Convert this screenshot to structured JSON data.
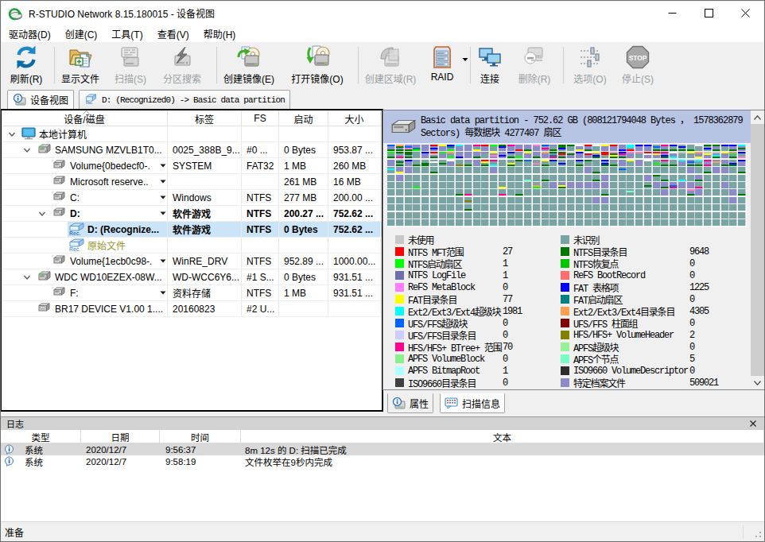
{
  "window": {
    "title": "R-STUDIO Network 8.15.180015 - 设备视图"
  },
  "menu": {
    "items": [
      "驱动器(D)",
      "创建(C)",
      "工具(T)",
      "查看(V)",
      "帮助(H)"
    ]
  },
  "toolbar": {
    "items": [
      {
        "id": "refresh",
        "label": "刷新(R)",
        "icon": "refresh-icon",
        "enabled": true
      },
      {
        "id": "show-files",
        "label": "显示文件",
        "icon": "show-files-icon",
        "enabled": true
      },
      {
        "id": "scan",
        "label": "扫描(S)",
        "icon": "scan-icon",
        "enabled": false
      },
      {
        "id": "search-partition",
        "label": "分区搜索",
        "icon": "partition-search-icon",
        "enabled": false
      },
      {
        "id": "create-image",
        "label": "创建镜像(E)",
        "icon": "create-image-icon",
        "enabled": true
      },
      {
        "id": "open-image",
        "label": "打开镜像(O)",
        "icon": "open-image-icon",
        "enabled": true
      },
      {
        "id": "create-region",
        "label": "创建区域(R)",
        "icon": "create-region-icon",
        "enabled": false
      },
      {
        "id": "raid",
        "label": "RAID",
        "icon": "raid-icon",
        "enabled": true,
        "dropdown": true
      },
      {
        "id": "connect",
        "label": "连接",
        "icon": "connect-icon",
        "enabled": true
      },
      {
        "id": "delete",
        "label": "删除(R)",
        "icon": "delete-icon",
        "enabled": false
      },
      {
        "id": "options",
        "label": "选项(O)",
        "icon": "options-icon",
        "enabled": false
      },
      {
        "id": "stop",
        "label": "停止(S)",
        "icon": "stop-icon",
        "enabled": false
      }
    ]
  },
  "tabs": [
    {
      "label": "设备视图",
      "icon": "device-view-icon",
      "active": true
    },
    {
      "label": "D: (Recognized0) -> Basic data partition",
      "icon": "recognized-icon",
      "active": false
    }
  ],
  "tree": {
    "columns": [
      "设备/磁盘",
      "标签",
      "FS",
      "启动",
      "大小"
    ],
    "rows": [
      {
        "indent": 0,
        "expander": true,
        "icon": "computer",
        "name": "本地计算机",
        "label": "",
        "fs": "",
        "start": "",
        "size": ""
      },
      {
        "indent": 1,
        "expander": true,
        "icon": "disk",
        "name": "SAMSUNG MZVLB1T0...",
        "label": "0025_388B_9...",
        "fs": "#0 ...",
        "start": "0 Bytes",
        "size": "953.87 ..."
      },
      {
        "indent": 2,
        "expander": false,
        "icon": "volume",
        "name": "Volume{0bedecf0-.",
        "dropdown": true,
        "label": "SYSTEM",
        "fs": "FAT32",
        "start": "1 MB",
        "size": "260 MB"
      },
      {
        "indent": 2,
        "expander": false,
        "icon": "volume",
        "name": "Microsoft reserve..",
        "dropdown": true,
        "label": "",
        "fs": "",
        "start": "261 MB",
        "size": "16 MB"
      },
      {
        "indent": 2,
        "expander": false,
        "icon": "volume",
        "name": "C:",
        "dropdown": true,
        "label": "Windows",
        "fs": "NTFS",
        "start": "277 MB",
        "size": "200.00 ..."
      },
      {
        "indent": 2,
        "expander": true,
        "icon": "volume",
        "name": "D:",
        "dropdown": true,
        "label": "软件游戏",
        "fs": "NTFS",
        "start": "200.27 ...",
        "size": "752.62 ...",
        "bold": true
      },
      {
        "indent": 3,
        "expander": false,
        "icon": "rec",
        "name": "D: (Recognize...",
        "label": "软件游戏",
        "fs": "NTFS",
        "start": "0 Bytes",
        "size": "752.62 ...",
        "bold": true,
        "selected": true
      },
      {
        "indent": 3,
        "expander": false,
        "icon": "rec",
        "name": "原始文件",
        "label": "",
        "fs": "",
        "start": "",
        "size": "",
        "olive": true
      },
      {
        "indent": 2,
        "expander": false,
        "icon": "volume",
        "name": "Volume{1ecb0c98-.",
        "dropdown": true,
        "label": "WinRE_DRV",
        "fs": "NTFS",
        "start": "952.89 ...",
        "size": "1000.00..."
      },
      {
        "indent": 1,
        "expander": true,
        "icon": "disk",
        "name": "WDC WD10EZEX-08W...",
        "label": "WD-WCC6Y6...",
        "fs": "#1 S...",
        "start": "0 Bytes",
        "size": "931.51 ..."
      },
      {
        "indent": 2,
        "expander": false,
        "icon": "volume",
        "name": "F:",
        "dropdown": true,
        "label": "资料存储",
        "fs": "NTFS",
        "start": "1 MB",
        "size": "931.51 ..."
      },
      {
        "indent": 1,
        "expander": false,
        "icon": "optical",
        "name": "BR17 DEVICE V1.00 1....",
        "label": "20160823",
        "fs": "#2 U...",
        "start": "",
        "size": ""
      }
    ]
  },
  "scan": {
    "header_lines": [
      "Basic data partition - 752.62 GB (808121794048 Bytes ， 1578362879",
      "Sectors) 每数据块 4277407 扇区"
    ],
    "legend_left": [
      {
        "label": "未使用",
        "color": "#c8c8c8",
        "count": ""
      },
      {
        "label": "NTFS MFT范围",
        "color": "#ff0000",
        "count": "27"
      },
      {
        "label": "NTFS启动扇区",
        "color": "#00ff00",
        "count": "1"
      },
      {
        "label": "NTFS LogFile",
        "color": "#6e6eaa",
        "count": "1"
      },
      {
        "label": "ReFS MetaBlock",
        "color": "#ff7dff",
        "count": "0"
      },
      {
        "label": "FAT目录条目",
        "color": "#ffff00",
        "count": "77"
      },
      {
        "label": "Ext2/Ext3/Ext4超级块",
        "color": "#00ffff",
        "count": "1981"
      },
      {
        "label": "UFS/FFS超级块",
        "color": "#0064ff",
        "count": "0"
      },
      {
        "label": "UFS/FFS目录条目",
        "color": "#ccccff",
        "count": "0"
      },
      {
        "label": "HFS/HFS+ BTree+ 范围",
        "color": "#ff0090",
        "count": "70"
      },
      {
        "label": "APFS VolumeBlock",
        "color": "#8cee8c",
        "count": "0"
      },
      {
        "label": "APFS BitmapRoot",
        "color": "#b0ffff",
        "count": "1"
      },
      {
        "label": "ISO9660目录条目",
        "color": "#404040",
        "count": "0"
      }
    ],
    "legend_right": [
      {
        "label": "未识别",
        "color": "#7aa4a4",
        "count": ""
      },
      {
        "label": "NTFS目录条目",
        "color": "#007800",
        "count": "9648"
      },
      {
        "label": "NTFS恢复点",
        "color": "#00c800",
        "count": "0"
      },
      {
        "label": "ReFS BootRecord",
        "color": "#ff6e6e",
        "count": "0"
      },
      {
        "label": "FAT 表格项",
        "color": "#0000ff",
        "count": "1225"
      },
      {
        "label": "FAT启动扇区",
        "color": "#008080",
        "count": "0"
      },
      {
        "label": "Ext2/Ext3/Ext4目录条目",
        "color": "#ffa050",
        "count": "4305"
      },
      {
        "label": "UFS/FFS 柱面组",
        "color": "#820000",
        "count": "0"
      },
      {
        "label": "HFS/HFS+ VolumeHeader",
        "color": "#828200",
        "count": "2"
      },
      {
        "label": "APFS超级块",
        "color": "#96f096",
        "count": "0"
      },
      {
        "label": "APFS个节点",
        "color": "#78ffc8",
        "count": "5"
      },
      {
        "label": "ISO9660 VolumeDescriptor",
        "color": "#2d2d2d",
        "count": "0"
      },
      {
        "label": "特定档案文件",
        "color": "#8b8bc8",
        "count": "509021"
      }
    ],
    "map": {
      "cols": 42,
      "rows": 11,
      "pitch_x": 10.762,
      "pitch_y": 9.4,
      "block_w": 9.4,
      "block_h": 8.1,
      "seed": 7,
      "base_unrecognized": "#7aa4a4",
      "base_file": "#8b8bc8",
      "row_file_prob": [
        0.8,
        0.72,
        0.45,
        0.16,
        0.1,
        0.16,
        0.1,
        0.03,
        0.0,
        0.0,
        0.0
      ],
      "row_block_prob": [
        0.97,
        0.93,
        0.55,
        0.25,
        0.12,
        0.16,
        0.1,
        0.03,
        0.004,
        0.0,
        0.0
      ],
      "dense_band_prob": [
        0.85,
        0.32,
        0.25,
        0.65
      ],
      "top_palette": [
        [
          "#0000ff",
          16
        ],
        [
          "#007800",
          14
        ],
        [
          "#ff0000",
          11
        ],
        [
          "#ffff00",
          11
        ],
        [
          "#8b8bc8",
          10
        ],
        [
          "#ff0090",
          7
        ],
        [
          "#00ffff",
          6
        ],
        [
          "#ffa050",
          7
        ],
        [
          "#ffffff",
          5
        ],
        [
          "#00ff00",
          4
        ],
        [
          "#ff80c0",
          4
        ],
        [
          "#008080",
          4
        ],
        [
          "#c8c8c8",
          4
        ],
        [
          "#0064ff",
          5
        ]
      ],
      "bottom_palette": [
        [
          "#007800",
          60
        ],
        [
          "#00ff00",
          6
        ],
        [
          "#0000ff",
          6
        ],
        [
          "#ff0090",
          6
        ],
        [
          "#ffff00",
          5
        ],
        [
          "#ff0000",
          4
        ],
        [
          "#ffa050",
          4
        ],
        [
          "#00ffff",
          3
        ],
        [
          "#828200",
          3
        ],
        [
          "#ff80c0",
          3
        ]
      ],
      "sparse_palette": [
        [
          "#007800",
          26
        ],
        [
          "#0000ff",
          12
        ],
        [
          "#ff0090",
          9
        ],
        [
          "#ff0000",
          8
        ],
        [
          "#ffff00",
          8
        ],
        [
          "#ffa050",
          8
        ],
        [
          "#00ffff",
          6
        ],
        [
          "#00ff00",
          5
        ],
        [
          "#ff80c0",
          5
        ],
        [
          "#828200",
          4
        ],
        [
          "#0064ff",
          4
        ],
        [
          "#008080",
          3
        ],
        [
          "#78ffc8",
          3
        ],
        [
          "#96f096",
          2
        ]
      ]
    }
  },
  "subtabs": [
    {
      "label": "属性",
      "icon": "properties-icon",
      "active": false
    },
    {
      "label": "扫描信息",
      "icon": "scan-info-icon",
      "active": true
    }
  ],
  "log": {
    "title": "日志",
    "columns": [
      "类型",
      "日期",
      "时间",
      "文本"
    ],
    "rows": [
      {
        "type": "系统",
        "date": "2020/12/7",
        "time": "9:56:37",
        "text": "8m 12s 的 D: 扫描已完成",
        "selected": true
      },
      {
        "type": "系统",
        "date": "2020/12/7",
        "time": "9:58:19",
        "text": "文件枚举在9秒内完成",
        "selected": false
      }
    ]
  },
  "statusbar": {
    "text": "准备"
  }
}
